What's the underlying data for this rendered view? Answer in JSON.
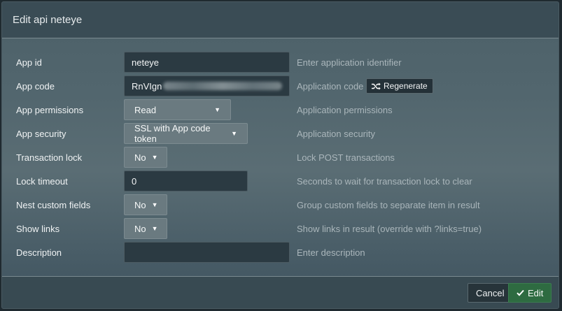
{
  "modal": {
    "title": "Edit api neteye"
  },
  "fields": {
    "app_id": {
      "label": "App id",
      "value": "neteye",
      "help": "Enter application identifier"
    },
    "app_code": {
      "label": "App code",
      "value_visible": "RnVIgn",
      "help": "Application code",
      "regenerate_label": "Regenerate"
    },
    "app_permissions": {
      "label": "App permissions",
      "value": "Read",
      "help": "Application permissions"
    },
    "app_security": {
      "label": "App security",
      "value": "SSL with App code token",
      "help": "Application security"
    },
    "transaction_lock": {
      "label": "Transaction lock",
      "value": "No",
      "help": "Lock POST transactions"
    },
    "lock_timeout": {
      "label": "Lock timeout",
      "value": "0",
      "help": "Seconds to wait for transaction lock to clear"
    },
    "nest_custom_fields": {
      "label": "Nest custom fields",
      "value": "No",
      "help": "Group custom fields to separate item in result"
    },
    "show_links": {
      "label": "Show links",
      "value": "No",
      "help": "Show links in result (override with ?links=true)"
    },
    "description": {
      "label": "Description",
      "value": "",
      "help": "Enter description"
    }
  },
  "footer": {
    "cancel_label": "Cancel",
    "edit_label": "Edit"
  },
  "icons": {
    "regenerate": "shuffle-icon",
    "edit": "check-icon",
    "select": "caret-down-icon"
  }
}
